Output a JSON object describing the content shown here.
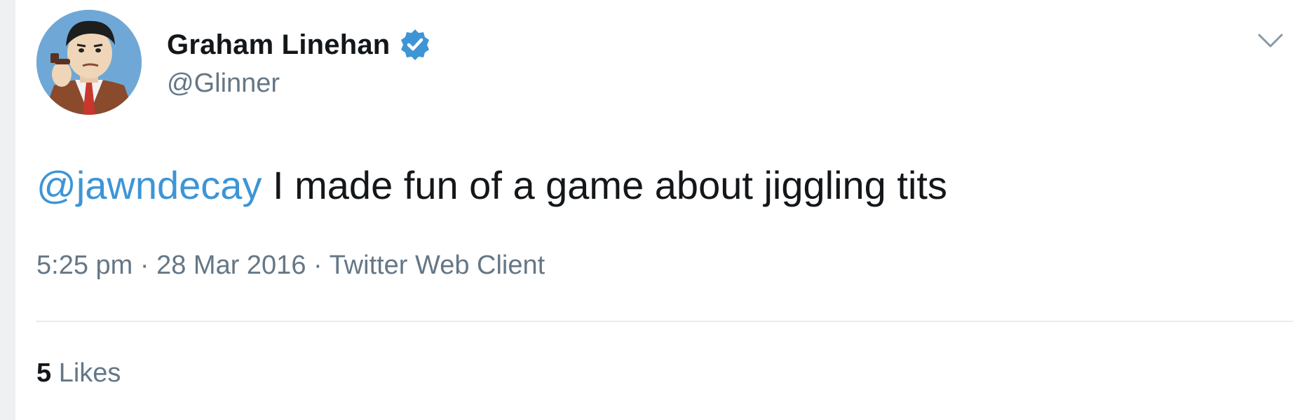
{
  "tweet": {
    "author": {
      "display_name": "Graham Linehan",
      "handle": "@Glinner",
      "verified": true
    },
    "text": {
      "mention": "@jawndecay",
      "body": " I made fun of a game about jiggling tits"
    },
    "meta": {
      "time": "5:25 pm",
      "separator": " · ",
      "date": "28 Mar 2016",
      "source": "Twitter Web Client"
    },
    "stats": {
      "likes_count": "5",
      "likes_label": " Likes"
    }
  },
  "icons": {
    "verified": "verified-badge-icon",
    "menu": "chevron-down-icon"
  },
  "colors": {
    "link": "#3d95d6",
    "secondary_text": "#657786",
    "verified_badge": "#3d95d6"
  }
}
